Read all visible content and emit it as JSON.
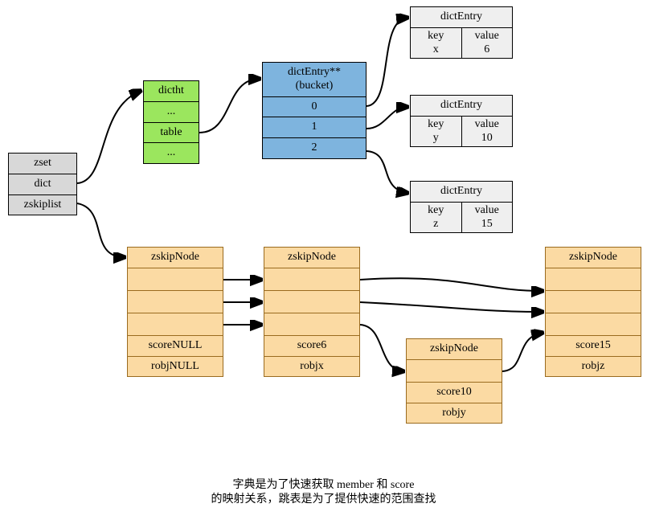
{
  "zset": {
    "title": "zset",
    "dict": "dict",
    "zskiplist": "zskiplist"
  },
  "dictht": {
    "title": "dictht",
    "dots1": "...",
    "table": "table",
    "dots2": "..."
  },
  "bucket": {
    "title": "dictEntry**\n(bucket)",
    "slots": [
      "0",
      "1",
      "2"
    ]
  },
  "entries": [
    {
      "title": "dictEntry",
      "key_label": "key",
      "key_val": "x",
      "value_label": "value",
      "value_val": "6"
    },
    {
      "title": "dictEntry",
      "key_label": "key",
      "key_val": "y",
      "value_label": "value",
      "value_val": "10"
    },
    {
      "title": "dictEntry",
      "key_label": "key",
      "key_val": "z",
      "value_label": "value",
      "value_val": "15"
    }
  ],
  "zskip": {
    "head": {
      "title": "zskipNode",
      "levels": [
        "",
        "",
        ""
      ],
      "score_label": "score",
      "score_val": "NULL",
      "robj_label": "robj",
      "robj_val": "NULL"
    },
    "n1": {
      "title": "zskipNode",
      "levels": [
        "",
        "",
        ""
      ],
      "score_label": "score",
      "score_val": "6",
      "robj_label": "robj",
      "robj_val": "x"
    },
    "n2": {
      "title": "zskipNode",
      "levels": [
        ""
      ],
      "score_label": "score",
      "score_val": "10",
      "robj_label": "robj",
      "robj_val": "y"
    },
    "n3": {
      "title": "zskipNode",
      "levels": [
        "",
        "",
        ""
      ],
      "score_label": "score",
      "score_val": "15",
      "robj_label": "robj",
      "robj_val": "z"
    }
  },
  "caption": {
    "line1_a": "字典是为了快速获取 member 和 score",
    "line1_b": "的映射关系，跳表是为了提供快速的范围查找"
  }
}
